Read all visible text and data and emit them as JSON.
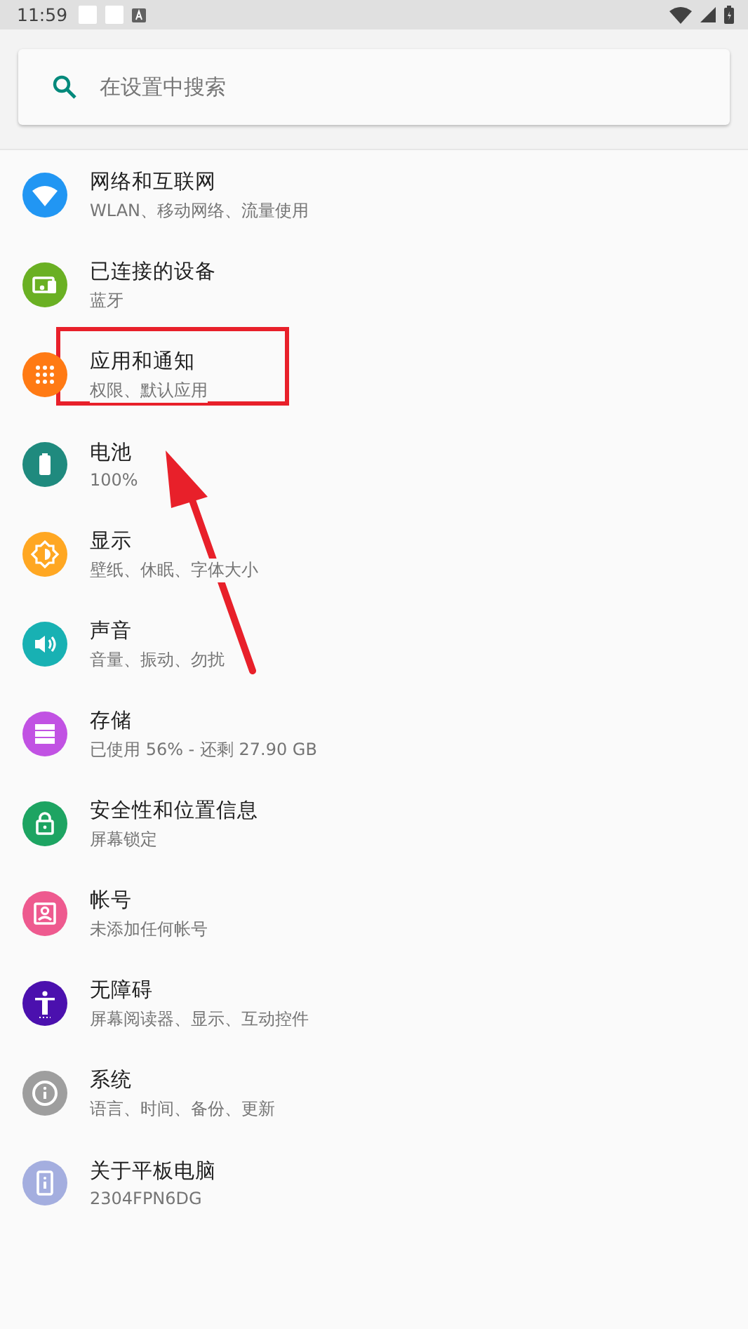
{
  "status_bar": {
    "time": "11:59"
  },
  "search": {
    "placeholder": "在设置中搜索"
  },
  "items": [
    {
      "title": "网络和互联网",
      "subtitle": "WLAN、移动网络、流量使用",
      "color": "#2196f3"
    },
    {
      "title": "已连接的设备",
      "subtitle": "蓝牙",
      "color": "#6ab023"
    },
    {
      "title": "应用和通知",
      "subtitle": "权限、默认应用",
      "color": "#ff7a14"
    },
    {
      "title": "电池",
      "subtitle": "100%",
      "color": "#1f8a7e"
    },
    {
      "title": "显示",
      "subtitle": "壁纸、休眠、字体大小",
      "color": "#ffa722"
    },
    {
      "title": "声音",
      "subtitle": "音量、振动、勿扰",
      "color": "#18b1b3"
    },
    {
      "title": "存储",
      "subtitle": "已使用 56% - 还剩 27.90 GB",
      "color": "#c152e3"
    },
    {
      "title": "安全性和位置信息",
      "subtitle": "屏幕锁定",
      "color": "#1da462"
    },
    {
      "title": "帐号",
      "subtitle": "未添加任何帐号",
      "color": "#ee5a8f"
    },
    {
      "title": "无障碍",
      "subtitle": "屏幕阅读器、显示、互动控件",
      "color": "#4b10ae"
    },
    {
      "title": "系统",
      "subtitle": "语言、时间、备份、更新",
      "color": "#9e9e9e"
    },
    {
      "title": "关于平板电脑",
      "subtitle": "2304FPN6DG",
      "color": "#a4aedf"
    }
  ],
  "annotations": {
    "highlight_box": true,
    "arrow": true
  }
}
